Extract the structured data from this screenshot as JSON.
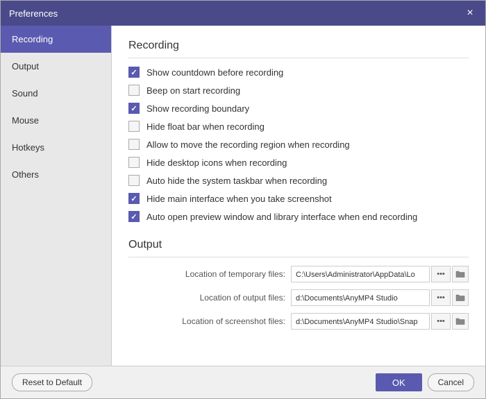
{
  "titleBar": {
    "title": "Preferences",
    "closeLabel": "×"
  },
  "sidebar": {
    "items": [
      {
        "id": "recording",
        "label": "Recording",
        "active": true
      },
      {
        "id": "output",
        "label": "Output",
        "active": false
      },
      {
        "id": "sound",
        "label": "Sound",
        "active": false
      },
      {
        "id": "mouse",
        "label": "Mouse",
        "active": false
      },
      {
        "id": "hotkeys",
        "label": "Hotkeys",
        "active": false
      },
      {
        "id": "others",
        "label": "Others",
        "active": false
      }
    ]
  },
  "recordingSection": {
    "title": "Recording",
    "checkboxes": [
      {
        "id": "countdown",
        "label": "Show countdown before recording",
        "checked": true
      },
      {
        "id": "beep",
        "label": "Beep on start recording",
        "checked": false
      },
      {
        "id": "boundary",
        "label": "Show recording boundary",
        "checked": true
      },
      {
        "id": "floatbar",
        "label": "Hide float bar when recording",
        "checked": false
      },
      {
        "id": "moveregion",
        "label": "Allow to move the recording region when recording",
        "checked": false
      },
      {
        "id": "desktopicons",
        "label": "Hide desktop icons when recording",
        "checked": false
      },
      {
        "id": "taskbar",
        "label": "Auto hide the system taskbar when recording",
        "checked": false
      },
      {
        "id": "hideinterface",
        "label": "Hide main interface when you take screenshot",
        "checked": true
      },
      {
        "id": "autoopen",
        "label": "Auto open preview window and library interface when end recording",
        "checked": true
      }
    ]
  },
  "outputSection": {
    "title": "Output",
    "rows": [
      {
        "label": "Location of temporary files:",
        "value": "C:\\Users\\Administrator\\AppData\\Lo",
        "dotsLabel": "•••"
      },
      {
        "label": "Location of output files:",
        "value": "d:\\Documents\\AnyMP4 Studio",
        "dotsLabel": "•••"
      },
      {
        "label": "Location of screenshot files:",
        "value": "d:\\Documents\\AnyMP4 Studio\\Snap",
        "dotsLabel": "•••"
      }
    ]
  },
  "footer": {
    "resetLabel": "Reset to Default",
    "okLabel": "OK",
    "cancelLabel": "Cancel"
  }
}
